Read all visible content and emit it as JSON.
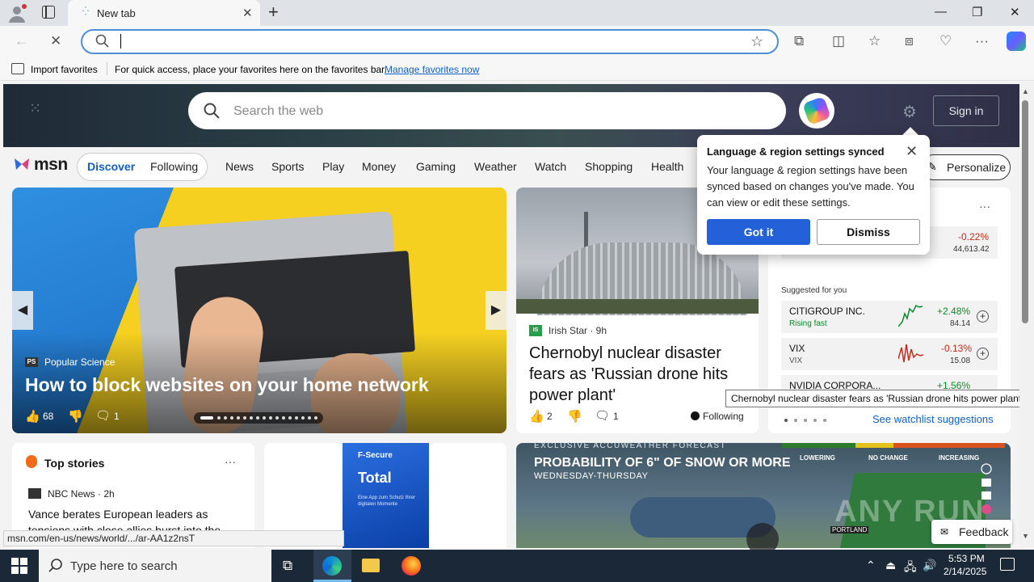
{
  "browser": {
    "tab_title": "New tab",
    "favorites_bar": {
      "import_label": "Import favorites",
      "hint": "For quick access, place your favorites here on the favorites bar.",
      "manage_link": "Manage favorites now"
    }
  },
  "msn": {
    "search_placeholder": "Search the web",
    "signin_label": "Sign in",
    "logo_text": "msn",
    "pill": {
      "discover": "Discover",
      "following": "Following"
    },
    "nav": [
      "News",
      "Sports",
      "Play",
      "Money",
      "Gaming",
      "Weather",
      "Watch",
      "Shopping",
      "Health"
    ],
    "personalize_label": "Personalize"
  },
  "main_story": {
    "source": "Popular Science",
    "source_badge": "PS",
    "title": "How to block websites on your home network",
    "likes": "68",
    "comments": "1"
  },
  "side_story": {
    "source": "Irish Star · 9h",
    "title": "Chernobyl nuclear disaster fears as 'Russian drone hits power plant'",
    "likes": "2",
    "comments": "1",
    "following_label": "Following"
  },
  "watchlist": {
    "top": {
      "pct": "-0.22%",
      "price": "44,613.42"
    },
    "suggested_label": "Suggested for you",
    "items": [
      {
        "name": "CITIGROUP INC.",
        "sub": "Rising fast",
        "pct": "+2.48%",
        "price": "84.14"
      },
      {
        "name": "VIX",
        "sub": "VIX",
        "pct": "-0.13%",
        "price": "15.08"
      },
      {
        "name": "NVIDIA CORPORA...",
        "sub": "",
        "pct": "+1.56%",
        "price": ""
      }
    ],
    "see_suggestions": "See watchlist suggestions"
  },
  "popup": {
    "title": "Language & region settings synced",
    "body": "Your language & region settings have been synced based on changes you've made. You can view or edit these settings.",
    "got_it": "Got it",
    "dismiss": "Dismiss"
  },
  "tooltip": "Chernobyl nuclear disaster fears as 'Russian drone hits power plant'",
  "top_stories": {
    "title": "Top stories",
    "source": "NBC News · 2h",
    "headline": "Vance berates European leaders as tensions with close allies burst into the"
  },
  "ad": {
    "brand": "F-Secure",
    "product": "Total",
    "tagline": "Eine App zum Schutz Ihrer digitalen Momente"
  },
  "weather_video": {
    "kicker": "EXCLUSIVE ACCUWEATHER FORECAST",
    "title": "PROBABILITY OF 6\" OF SNOW OR MORE",
    "subtitle": "WEDNESDAY-THURSDAY",
    "legend": [
      "LOWERING",
      "NO CHANGE",
      "INCREASING"
    ],
    "city": "PORTLAND"
  },
  "watermark": "ANY RUN",
  "feedback_label": "Feedback",
  "status_url": "msn.com/en-us/news/world/.../ar-AA1z2nsT",
  "taskbar": {
    "search_placeholder": "Type here to search",
    "time": "5:53 PM",
    "date": "2/14/2025"
  }
}
